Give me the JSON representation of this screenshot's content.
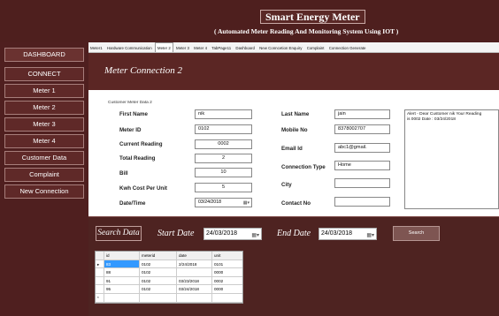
{
  "header": {
    "title": "Smart Energy Meter",
    "subtitle": "( Automated Meter Reading And Monitoring System Using IOT )"
  },
  "sidebar": {
    "items": [
      {
        "label": "DASHBOARD"
      },
      {
        "label": "CONNECT"
      },
      {
        "label": "Meter 1"
      },
      {
        "label": "Meter 2"
      },
      {
        "label": "Meter 3"
      },
      {
        "label": "Meter 4"
      },
      {
        "label": "Customer Data"
      },
      {
        "label": "Complaint"
      },
      {
        "label": "New Connection"
      }
    ]
  },
  "tabs": [
    {
      "label": "Meter1"
    },
    {
      "label": "Hardware Communication"
    },
    {
      "label": "Meter 2"
    },
    {
      "label": "Meter 3"
    },
    {
      "label": "Meter 4"
    },
    {
      "label": "TabPage11"
    },
    {
      "label": "Dashboard"
    },
    {
      "label": "New Conncetion Enquiry"
    },
    {
      "label": "Complaint"
    },
    {
      "label": "Connection Generate"
    }
  ],
  "panel": {
    "title": "Meter Connection 2",
    "group_label": "Customer Meter Data 2"
  },
  "form": {
    "first_name": {
      "label": "First Name",
      "value": "nik"
    },
    "meter_id": {
      "label": "Meter ID",
      "value": "0102"
    },
    "current_reading": {
      "label": "Current Reading",
      "value": "0002"
    },
    "total_reading": {
      "label": "Total Reading",
      "value": "2"
    },
    "bill": {
      "label": "Bill",
      "value": "10"
    },
    "kwh_cost": {
      "label": "Kwh Cost Per Unit",
      "value": "5"
    },
    "date_time": {
      "label": "Date/Time",
      "value": "03/24/2018"
    },
    "last_name": {
      "label": "Last Name",
      "value": "jain"
    },
    "mobile_no": {
      "label": "Mobile No",
      "value": "8378002707"
    },
    "email": {
      "label": "Email Id",
      "value": "abc1@gmail."
    },
    "connection_type": {
      "label": "Connection Type",
      "value": "Home"
    },
    "city": {
      "label": "City",
      "value": ""
    },
    "contact_no": {
      "label": "Contact No",
      "value": ""
    }
  },
  "alert": {
    "line1": "Alert - Dear Customer nik Your Reading",
    "line2": "is 0002 Date : 03/24/2018"
  },
  "search": {
    "label": "Search Data",
    "start_label": "Start Date",
    "start_value": "24/03/2018",
    "end_label": "End Date",
    "end_value": "24/03/2018",
    "button": "Search"
  },
  "grid": {
    "columns": [
      "id",
      "meterid",
      "date",
      "unit"
    ],
    "rows": [
      {
        "marker": "▸",
        "cells": [
          "83",
          "0102",
          "2/24/2018",
          "0101"
        ]
      },
      {
        "marker": "",
        "cells": [
          "88",
          "0102",
          "",
          "0000"
        ]
      },
      {
        "marker": "",
        "cells": [
          "91",
          "0102",
          "03/23/2018",
          "0002"
        ]
      },
      {
        "marker": "",
        "cells": [
          "95",
          "0102",
          "03/24/2018",
          "0000"
        ]
      },
      {
        "marker": "*",
        "cells": [
          "",
          "",
          "",
          ""
        ]
      }
    ]
  },
  "icons": {
    "calendar": "calendar-icon",
    "row_pointer": "row-pointer-icon"
  },
  "colors": {
    "header_bg": "#4e1f1e",
    "sidebar_bg": "#4f1f1f",
    "panel_bg": "#5b2624",
    "search_bg": "#4e2321",
    "selection": "#3399ff"
  }
}
